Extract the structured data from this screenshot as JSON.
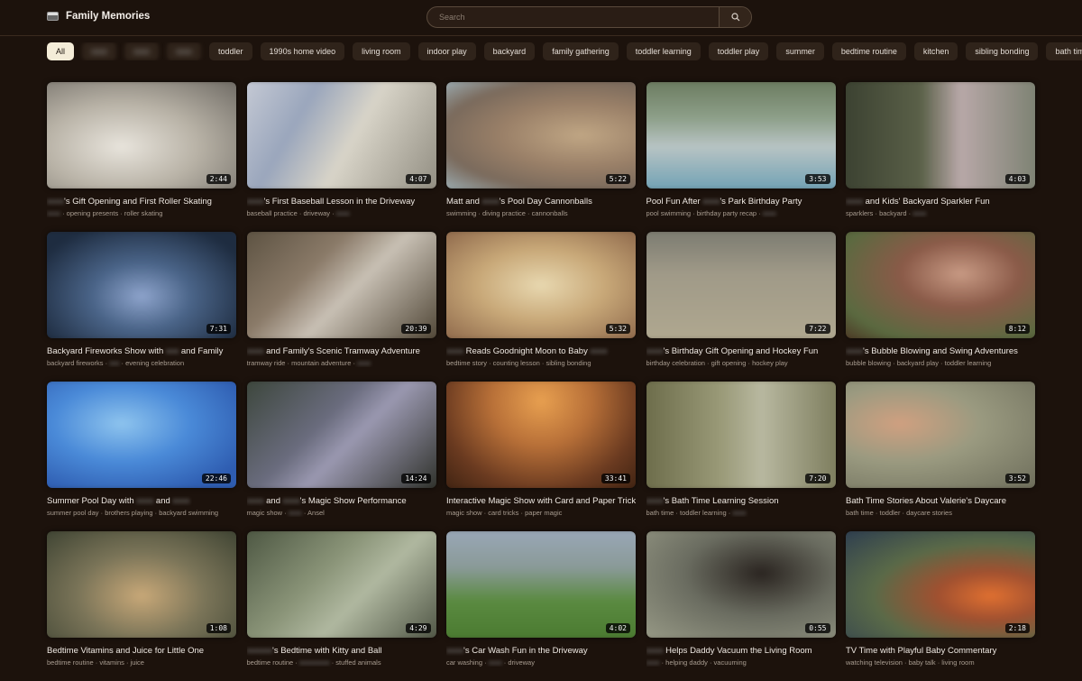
{
  "app": {
    "title": "Family Memories",
    "logo_icon": "film-icon"
  },
  "search": {
    "placeholder": "Search",
    "button_icon": "search-icon"
  },
  "chips": [
    {
      "label": "All",
      "active": true
    },
    {
      "label": "xxxx",
      "blurred": true
    },
    {
      "label": "xxxx",
      "blurred": true
    },
    {
      "label": "xxxx",
      "blurred": true
    },
    {
      "label": "toddler"
    },
    {
      "label": "1990s home video"
    },
    {
      "label": "living room"
    },
    {
      "label": "indoor play"
    },
    {
      "label": "backyard"
    },
    {
      "label": "family gathering"
    },
    {
      "label": "toddler learning"
    },
    {
      "label": "toddler play"
    },
    {
      "label": "summer"
    },
    {
      "label": "bedtime routine"
    },
    {
      "label": "kitchen"
    },
    {
      "label": "sibling bonding"
    },
    {
      "label": "bath time"
    }
  ],
  "videos": [
    {
      "duration": "2:44",
      "title": [
        {
          "t": "xxxx",
          "b": true
        },
        {
          "t": "'s Gift Opening and First Roller Skating"
        }
      ],
      "tags": [
        {
          "t": "xxxx",
          "b": true
        },
        {
          "t": " · opening presents · roller skating"
        }
      ],
      "bg": "radial-gradient(ellipse at 40% 60%, #e8e4dc 0%, #b8b2a6 45%, #6a6660 100%)"
    },
    {
      "duration": "4:07",
      "title": [
        {
          "t": "xxxx",
          "b": true
        },
        {
          "t": "'s First Baseball Lesson in the Driveway"
        }
      ],
      "tags": [
        {
          "t": "baseball practice · driveway · "
        },
        {
          "t": "xxxx",
          "b": true
        }
      ],
      "bg": "linear-gradient(120deg, #c8ccd6 0%, #9aa6bc 30%, #d8d4c8 55%, #8e8a7e 100%)"
    },
    {
      "duration": "5:22",
      "title": [
        {
          "t": "Matt and "
        },
        {
          "t": "xxxx",
          "b": true
        },
        {
          "t": "'s Pool Day Cannonballs"
        }
      ],
      "tags": [
        {
          "t": "swimming · diving practice · cannonballs"
        }
      ],
      "bg": "radial-gradient(ellipse at 70% 50%, #c0a684 0%, #9a8068 40%, #7a6a5c 70%, #a0b4bc 100%)"
    },
    {
      "duration": "3:53",
      "title": [
        {
          "t": "Pool Fun After "
        },
        {
          "t": "xxxx",
          "b": true
        },
        {
          "t": "'s Park Birthday Party"
        }
      ],
      "tags": [
        {
          "t": "pool swimming · birthday party recap · "
        },
        {
          "t": "xxxx",
          "b": true
        }
      ],
      "bg": "linear-gradient(180deg, #6a7a5e 0%, #8ea08a 35%, #b8c4c4 60%, #6ea0b4 100%)"
    },
    {
      "duration": "4:03",
      "title": [
        {
          "t": "xxxx",
          "b": true
        },
        {
          "t": " and Kids' Backyard Sparkler Fun"
        }
      ],
      "tags": [
        {
          "t": "sparklers · backyard · "
        },
        {
          "t": "xxxx",
          "b": true
        }
      ],
      "bg": "linear-gradient(90deg, #3a4030 0%, #5a6048 40%, #b8a8a8 60%, #7a8070 100%)"
    },
    {
      "duration": "7:31",
      "title": [
        {
          "t": "Backyard Fireworks Show with "
        },
        {
          "t": "xxx",
          "b": true
        },
        {
          "t": " and Family"
        }
      ],
      "tags": [
        {
          "t": "backyard fireworks · "
        },
        {
          "t": "xxx",
          "b": true
        },
        {
          "t": " · evening celebration"
        }
      ],
      "bg": "radial-gradient(ellipse at 50% 60%, #8ea4cc 0%, #4a6488 35%, #1e2c40 80%)"
    },
    {
      "duration": "20:39",
      "title": [
        {
          "t": "xxxx",
          "b": true
        },
        {
          "t": " and Family's Scenic Tramway Adventure"
        }
      ],
      "tags": [
        {
          "t": "tramway ride · mountain adventure · "
        },
        {
          "t": "xxxx",
          "b": true
        }
      ],
      "bg": "linear-gradient(135deg, #5a5040 0%, #8a7a68 35%, #c8c0b4 55%, #4a4030 100%)"
    },
    {
      "duration": "5:32",
      "title": [
        {
          "t": "xxxx",
          "b": true
        },
        {
          "t": " Reads Goodnight Moon to Baby "
        },
        {
          "t": "xxxx",
          "b": true
        }
      ],
      "tags": [
        {
          "t": "bedtime story · counting lesson · sibling bonding"
        }
      ],
      "bg": "radial-gradient(ellipse at 50% 50%, #e8d8b0 0%, #c8a878 45%, #8a6448 100%)"
    },
    {
      "duration": "7:22",
      "title": [
        {
          "t": "xxxx",
          "b": true
        },
        {
          "t": "'s Birthday Gift Opening and Hockey Fun"
        }
      ],
      "tags": [
        {
          "t": "birthday celebration · gift opening · hockey play"
        }
      ],
      "bg": "linear-gradient(180deg, #7a7a70 0%, #a09a88 40%, #b0a890 100%)"
    },
    {
      "duration": "8:12",
      "title": [
        {
          "t": "xxxx",
          "b": true
        },
        {
          "t": "'s Bubble Blowing and Swing Adventures"
        }
      ],
      "tags": [
        {
          "t": "bubble blowing · backyard play · toddler learning"
        }
      ],
      "bg": "radial-gradient(ellipse at 60% 40%, #c89a84 0%, #8a5a48 35%, #5a6a40 75%, #4a3020 100%)"
    },
    {
      "duration": "22:46",
      "title": [
        {
          "t": "Summer Pool Day with "
        },
        {
          "t": "xxxx",
          "b": true
        },
        {
          "t": " and "
        },
        {
          "t": "xxxx",
          "b": true
        }
      ],
      "tags": [
        {
          "t": "summer pool day · brothers playing · backyard swimming"
        }
      ],
      "bg": "radial-gradient(ellipse at 40% 40%, #8ec4ee 0%, #4a8ad8 40%, #2e5cb0 80%)"
    },
    {
      "duration": "14:24",
      "title": [
        {
          "t": "xxxx",
          "b": true
        },
        {
          "t": " and "
        },
        {
          "t": "xxxx",
          "b": true
        },
        {
          "t": "'s Magic Show Performance"
        }
      ],
      "tags": [
        {
          "t": "magic show · "
        },
        {
          "t": "xxxx",
          "b": true
        },
        {
          "t": " · Ansel"
        }
      ],
      "bg": "linear-gradient(135deg, #3a4438 0%, #6a6c7e 40%, #9a98b0 55%, #2a2c24 100%)"
    },
    {
      "duration": "33:41",
      "title": [
        {
          "t": "Interactive Magic Show with Card and Paper Tricks"
        }
      ],
      "tags": [
        {
          "t": "magic show · card tricks · paper magic"
        }
      ],
      "bg": "radial-gradient(ellipse at 50% 20%, #e8a050 0%, #b87038 35%, #6a3a20 70%, #3a2010 100%)"
    },
    {
      "duration": "7:20",
      "title": [
        {
          "t": "xxxx",
          "b": true
        },
        {
          "t": "'s Bath Time Learning Session"
        }
      ],
      "tags": [
        {
          "t": "bath time · toddler learning · "
        },
        {
          "t": "xxxx",
          "b": true
        }
      ],
      "bg": "linear-gradient(90deg, #6a6a48 0%, #9a9a78 40%, #b8b8a0 60%, #7a7a5a 100%)"
    },
    {
      "duration": "3:52",
      "title": [
        {
          "t": "Bath Time Stories About Valerie's Daycare"
        }
      ],
      "tags": [
        {
          "t": "bath time · toddler · daycare stories"
        }
      ],
      "bg": "radial-gradient(ellipse at 30% 40%, #d0a080 0%, #9a9a80 40%, #6a6a58 100%)"
    },
    {
      "duration": "1:08",
      "title": [
        {
          "t": "Bedtime Vitamins and Juice for Little One"
        }
      ],
      "tags": [
        {
          "t": "bedtime routine · vitamins · juice"
        }
      ],
      "bg": "radial-gradient(ellipse at 50% 60%, #c8a878 0%, #7a7458 45%, #3a4030 100%)"
    },
    {
      "duration": "4:29",
      "title": [
        {
          "t": "xxxxxx",
          "b": true
        },
        {
          "t": "'s Bedtime with Kitty and Ball"
        }
      ],
      "tags": [
        {
          "t": "bedtime routine · "
        },
        {
          "t": "xxxxxxxxx",
          "b": true
        },
        {
          "t": " · stuffed animals"
        }
      ],
      "bg": "linear-gradient(135deg, #4a5440 0%, #8a9478 40%, #b0b8a0 60%, #4a5040 100%)"
    },
    {
      "duration": "4:02",
      "title": [
        {
          "t": "xxxx",
          "b": true
        },
        {
          "t": "'s Car Wash Fun in the Driveway"
        }
      ],
      "tags": [
        {
          "t": "car washing · "
        },
        {
          "t": "xxxx",
          "b": true
        },
        {
          "t": " · driveway"
        }
      ],
      "bg": "linear-gradient(180deg, #9aa8b8 0%, #8a9a98 35%, #5a8a40 65%, #4a7a30 100%)"
    },
    {
      "duration": "0:55",
      "title": [
        {
          "t": "xxxx",
          "b": true
        },
        {
          "t": " Helps Daddy Vacuum the Living Room"
        }
      ],
      "tags": [
        {
          "t": "xxxx",
          "b": true
        },
        {
          "t": " · helping daddy · vacuuming"
        }
      ],
      "bg": "radial-gradient(ellipse at 60% 40%, #2a2420 0%, #6a6c60 45%, #9a9c88 100%)"
    },
    {
      "duration": "2:18",
      "title": [
        {
          "t": "TV Time with Playful Baby Commentary"
        }
      ],
      "tags": [
        {
          "t": "watching television · baby talk · living room"
        }
      ],
      "bg": "radial-gradient(ellipse at 75% 60%, #e07030 0%, #a05030 25%, #5a6a48 55%, #2a3a50 100%)"
    }
  ]
}
